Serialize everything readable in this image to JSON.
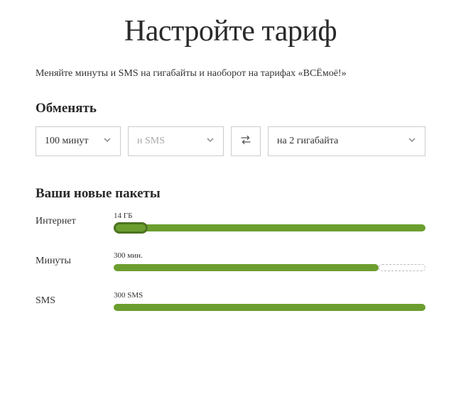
{
  "title": "Настройте тариф",
  "subtitle": "Меняйте минуты и SMS на гигабайты и наоборот на тарифах «ВСЁмоё!»",
  "exchange": {
    "heading": "Обменять",
    "minutes_value": "100 минут",
    "sms_placeholder": "и SMS",
    "result_value": "на 2 гигабайта"
  },
  "packages": {
    "heading": "Ваши новые пакеты",
    "items": [
      {
        "label": "Интернет",
        "value": "14 ГБ",
        "fill_percent": 100,
        "dashed_percent": 0,
        "show_knob": true
      },
      {
        "label": "Минуты",
        "value": "300 мин.",
        "fill_percent": 85,
        "dashed_percent": 15,
        "show_knob": false
      },
      {
        "label": "SMS",
        "value": "300 SMS",
        "fill_percent": 100,
        "dashed_percent": 0,
        "show_knob": false
      }
    ]
  }
}
